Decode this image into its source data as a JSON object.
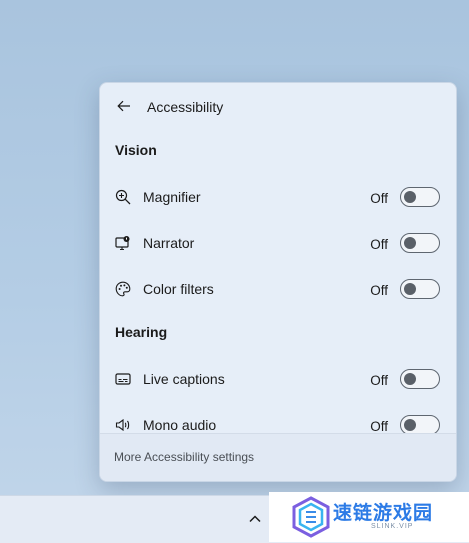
{
  "panel": {
    "title": "Accessibility",
    "sections": [
      {
        "title": "Vision",
        "items": [
          {
            "icon": "magnifier-icon",
            "label": "Magnifier",
            "state": "Off",
            "enabled": false
          },
          {
            "icon": "narrator-icon",
            "label": "Narrator",
            "state": "Off",
            "enabled": false
          },
          {
            "icon": "color-filters-icon",
            "label": "Color filters",
            "state": "Off",
            "enabled": false
          }
        ]
      },
      {
        "title": "Hearing",
        "items": [
          {
            "icon": "live-captions-icon",
            "label": "Live captions",
            "state": "Off",
            "enabled": false
          },
          {
            "icon": "mono-audio-icon",
            "label": "Mono audio",
            "state": "Off",
            "enabled": false
          }
        ]
      }
    ],
    "footer_link": "More Accessibility settings"
  },
  "taskbar": {
    "overflow_icon": "chevron-up-icon"
  },
  "watermark": {
    "text": "速链游戏园",
    "subtext": "SLINK.VIP",
    "icon": "watermark-logo"
  },
  "colors": {
    "panel_bg": "#e6eef8",
    "toggle_off_knob": "#5a6068",
    "watermark_blue": "#2c7be6"
  }
}
